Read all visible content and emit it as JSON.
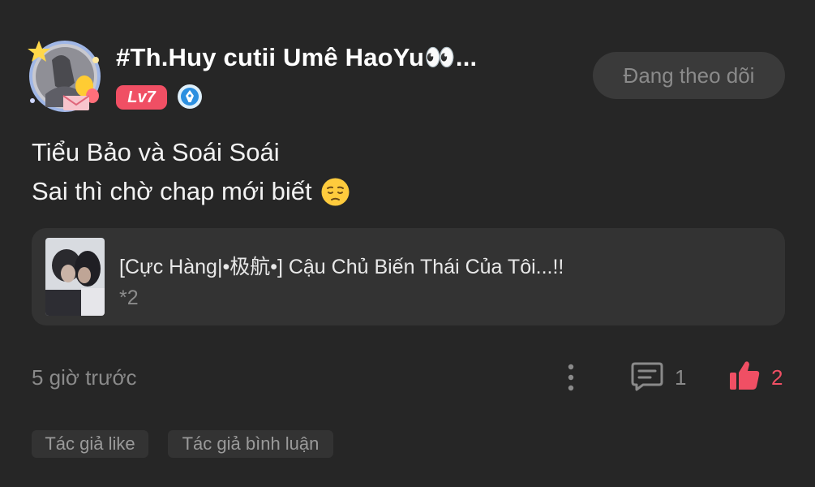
{
  "author": {
    "name": "#Th.Huy cutii Umê HaoYu👀...",
    "level": "Lv7",
    "avatar_icon": "avatar-with-stickers",
    "verify_icon": "pen-nib-badge-icon"
  },
  "follow_button": {
    "label": "Đang theo dõi"
  },
  "post": {
    "lines": [
      "Tiểu Bảo và Soái Soái",
      "Sai thì chờ chap mới biết"
    ],
    "emoji": "pensive-face-emoji"
  },
  "linked_story": {
    "title": "[Cực Hàng|•极航•] Cậu Chủ Biến Thái Của Tôi...!!",
    "subtitle": "*2"
  },
  "meta": {
    "timestamp": "5 giờ trước",
    "comment_count": "1",
    "like_count": "2"
  },
  "tags": [
    "Tác giả like",
    "Tác giả bình luận"
  ],
  "colors": {
    "background": "#262626",
    "accent": "#f04f64",
    "card": "#333333",
    "muted": "#8a8a8a"
  }
}
